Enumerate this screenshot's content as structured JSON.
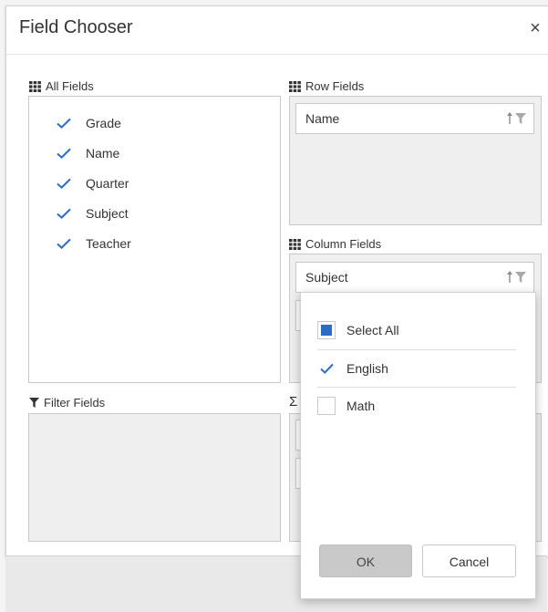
{
  "dialog": {
    "title": "Field Chooser",
    "close_glyph": "×"
  },
  "all_fields": {
    "title": "All Fields",
    "icon": "grid-icon",
    "items": [
      {
        "label": "Grade",
        "checked": true
      },
      {
        "label": "Name",
        "checked": true
      },
      {
        "label": "Quarter",
        "checked": true
      },
      {
        "label": "Subject",
        "checked": true
      },
      {
        "label": "Teacher",
        "checked": true
      }
    ]
  },
  "row_fields": {
    "title": "Row Fields",
    "icon": "grid-icon",
    "items": [
      {
        "label": "Name"
      }
    ]
  },
  "column_fields": {
    "title": "Column Fields",
    "icon": "grid-icon",
    "items": [
      {
        "label": "Subject"
      }
    ]
  },
  "filter_fields": {
    "title": "Filter Fields",
    "icon": "filter-icon"
  },
  "values_fields": {
    "title_visible": "Σ",
    "icon": "sigma-icon"
  },
  "filter_popup": {
    "select_all": {
      "label": "Select All",
      "state": "indeterminate"
    },
    "options": [
      {
        "label": "English",
        "checked": true
      },
      {
        "label": "Math",
        "checked": false
      }
    ],
    "ok_label": "OK",
    "cancel_label": "Cancel"
  },
  "colors": {
    "accent": "#2b6cc4",
    "check": "#2b6cc4",
    "icon_grey": "#9a9a9a"
  }
}
